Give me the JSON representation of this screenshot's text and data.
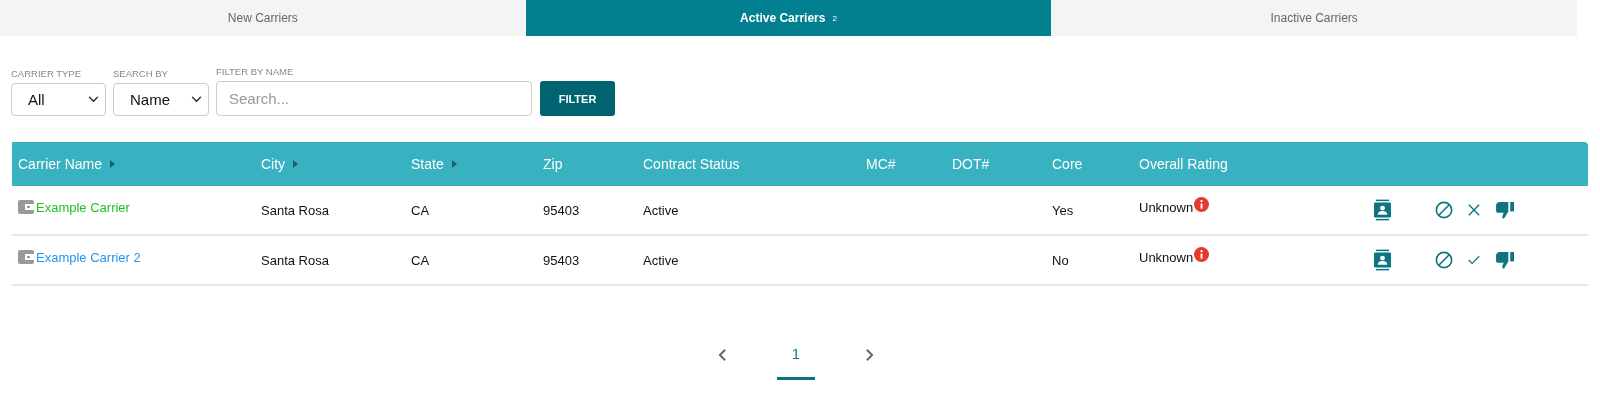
{
  "tabs": [
    {
      "label": "New Carriers",
      "selected": false
    },
    {
      "label": "Active Carriers",
      "count": "2",
      "selected": true
    },
    {
      "label": "Inactive Carriers",
      "selected": false
    }
  ],
  "filters": {
    "carrier_type": {
      "label": "CARRIER TYPE",
      "value": "All"
    },
    "search_by": {
      "label": "SEARCH BY",
      "value": "Name"
    },
    "filter_by_name": {
      "label": "FILTER BY NAME",
      "placeholder": "Search..."
    },
    "button": "FILTER"
  },
  "table": {
    "columns": [
      {
        "label": "Carrier Name",
        "sortable": true
      },
      {
        "label": "City",
        "sortable": true
      },
      {
        "label": "State",
        "sortable": true
      },
      {
        "label": "Zip",
        "sortable": false
      },
      {
        "label": "Contract Status",
        "sortable": false
      },
      {
        "label": "MC#",
        "sortable": false
      },
      {
        "label": "DOT#",
        "sortable": false
      },
      {
        "label": "Core",
        "sortable": false
      },
      {
        "label": "Overall Rating",
        "sortable": false
      }
    ],
    "rows": [
      {
        "name": "Example Carrier",
        "color": "#22c022",
        "city": "Santa Rosa",
        "state": "CA",
        "zip": "95403",
        "contract_status": "Active",
        "core": "Yes",
        "rating": "Unknown",
        "kind": "remove"
      },
      {
        "name": "Example Carrier 2",
        "color": "#2196f3",
        "city": "Santa Rosa",
        "state": "CA",
        "zip": "95403",
        "contract_status": "Active",
        "core": "No",
        "rating": "Unknown",
        "kind": "approve"
      }
    ]
  },
  "pagination": {
    "pages": [
      {
        "label": "1",
        "selected": true
      }
    ]
  }
}
